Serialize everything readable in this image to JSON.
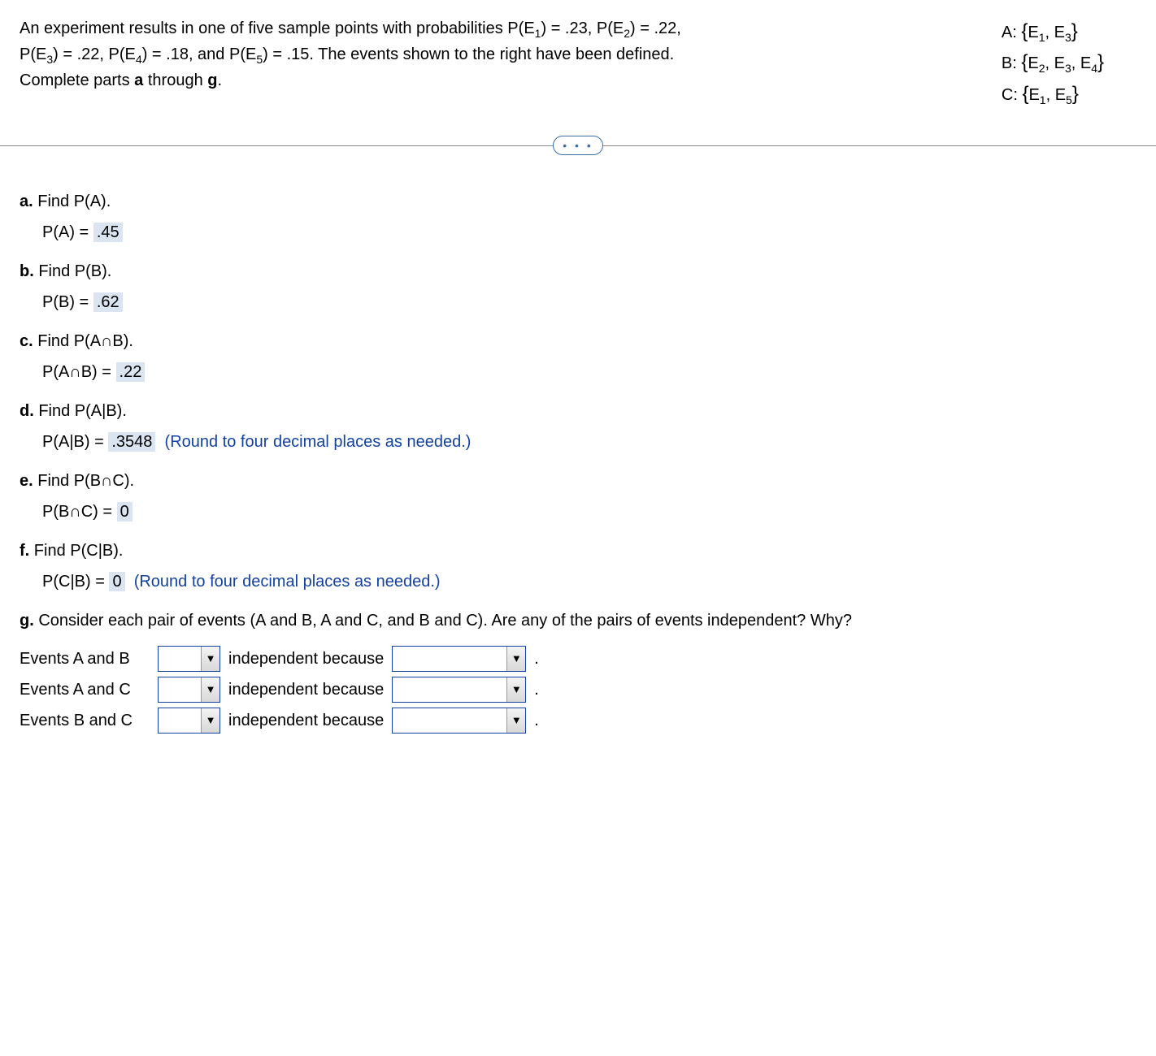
{
  "problem": "An experiment results in one of five sample points with probabilities P(E₁) = .23, P(E₂) = .22, P(E₃) = .22, P(E₄) = .18, and P(E₅) = .15. The events shown to the right have been defined. Complete parts a through g.",
  "events": {
    "a": "A: {E₁, E₃}",
    "b": "B: {E₂, E₃, E₄}",
    "c": "C: {E₁, E₅}"
  },
  "dotsLabel": "• • •",
  "parts": {
    "a": {
      "label": "a.",
      "prompt": "Find P(A).",
      "expr": "P(A) =",
      "value": ".45"
    },
    "b": {
      "label": "b.",
      "prompt": "Find P(B).",
      "expr": "P(B) =",
      "value": ".62"
    },
    "c": {
      "label": "c.",
      "prompt": "Find P(A∩B).",
      "expr": "P(A∩B) =",
      "value": ".22"
    },
    "d": {
      "label": "d.",
      "prompt": "Find P(A|B).",
      "expr": "P(A|B) =",
      "value": ".3548",
      "hint": "(Round to four decimal places as needed.)"
    },
    "e": {
      "label": "e.",
      "prompt": "Find P(B∩C).",
      "expr": "P(B∩C) =",
      "value": "0"
    },
    "f": {
      "label": "f.",
      "prompt": "Find P(C|B).",
      "expr": "P(C|B) =",
      "value": "0",
      "hint": "(Round to four decimal places as needed.)"
    },
    "g": {
      "label": "g.",
      "prompt": "Consider each pair of events (A and B, A and C, and B and C). Are any of the pairs of events independent? Why?"
    }
  },
  "gRows": {
    "ab": "Events A and B",
    "ac": "Events A and C",
    "bc": "Events B and C",
    "mid": "independent because",
    "period": "."
  },
  "dropdownGlyph": "▼"
}
